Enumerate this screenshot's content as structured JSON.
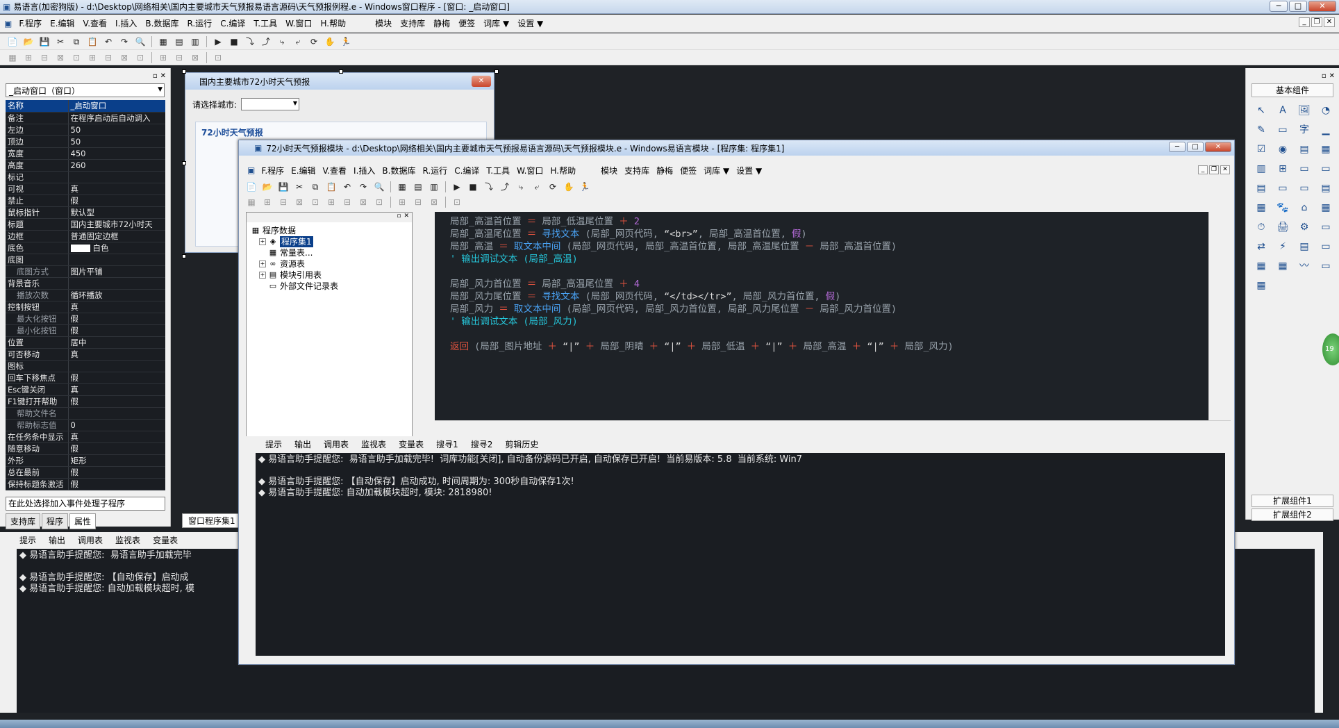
{
  "title": "易语言(加密狗版) - d:\\Desktop\\网络相关\\国内主要城市天气预报易语言源码\\天气预报例程.e - Windows窗口程序 - [窗口: _启动窗口]",
  "menu": [
    "F.程序",
    "E.编辑",
    "V.查看",
    "I.插入",
    "B.数据库",
    "R.运行",
    "C.编译",
    "T.工具",
    "W.窗口",
    "H.帮助"
  ],
  "menu_extra": [
    "模块",
    "支持库",
    "静梅",
    "便签",
    "词库 ▼",
    "设置 ▼"
  ],
  "toolbar1": [
    "📄",
    "📂",
    "💾",
    "✂",
    "⧉",
    "📋",
    "↶",
    "↷",
    "🔍",
    "▦",
    "▤",
    "▥",
    "▶",
    "■",
    "⤵",
    "⤴",
    "⤷",
    "⤶",
    "⟳",
    "✋",
    "🏃"
  ],
  "toolbar2": [
    "▦",
    "⊞",
    "⊟",
    "⊠",
    "⊡",
    "⊞",
    "⊟",
    "⊠",
    "⊡",
    "⊞",
    "⊟",
    "⊠",
    "⊡"
  ],
  "leftpanel": {
    "combo": "_启动窗口（窗口）",
    "props": [
      {
        "k": "名称",
        "v": "_启动窗口",
        "sel": true
      },
      {
        "k": "备注",
        "v": "在程序启动后自动调入"
      },
      {
        "k": "左边",
        "v": "50"
      },
      {
        "k": "顶边",
        "v": "50"
      },
      {
        "k": "宽度",
        "v": "450"
      },
      {
        "k": "高度",
        "v": "260"
      },
      {
        "k": "标记",
        "v": ""
      },
      {
        "k": "可视",
        "v": "真"
      },
      {
        "k": "禁止",
        "v": "假"
      },
      {
        "k": "鼠标指针",
        "v": "默认型"
      },
      {
        "k": "标题",
        "v": "国内主要城市72小时天"
      },
      {
        "k": "边框",
        "v": "普通固定边框"
      },
      {
        "k": "底色",
        "v": "白色",
        "color": true
      },
      {
        "k": "底图",
        "v": ""
      },
      {
        "k": "底图方式",
        "v": "图片平铺",
        "sub": true
      },
      {
        "k": "背景音乐",
        "v": ""
      },
      {
        "k": "播放次数",
        "v": "循环播放",
        "sub": true
      },
      {
        "k": "控制按钮",
        "v": "真"
      },
      {
        "k": "最大化按钮",
        "v": "假",
        "sub": true
      },
      {
        "k": "最小化按钮",
        "v": "假",
        "sub": true
      },
      {
        "k": "位置",
        "v": "居中"
      },
      {
        "k": "可否移动",
        "v": "真"
      },
      {
        "k": "图标",
        "v": ""
      },
      {
        "k": "回车下移焦点",
        "v": "假"
      },
      {
        "k": "Esc键关闭",
        "v": "真"
      },
      {
        "k": "F1键打开帮助",
        "v": "假"
      },
      {
        "k": "帮助文件名",
        "v": "",
        "sub": true
      },
      {
        "k": "帮助标志值",
        "v": "0",
        "sub": true
      },
      {
        "k": "在任务条中显示",
        "v": "真"
      },
      {
        "k": "随意移动",
        "v": "假"
      },
      {
        "k": "外形",
        "v": "矩形"
      },
      {
        "k": "总在最前",
        "v": "假"
      },
      {
        "k": "保持标题条激活",
        "v": "假"
      }
    ],
    "event_combo": "在此处选择加入事件处理子程序",
    "tabs": [
      "支持库",
      "程序",
      "属性"
    ],
    "doc_tab": "窗口程序集1"
  },
  "design": {
    "title": "国内主要城市72小时天气预报",
    "select_label": "请选择城市:",
    "group_title": "72小时天气预报"
  },
  "toolbox": {
    "title": "基本组件",
    "icons": [
      "↖",
      "A",
      "🖼",
      "◔",
      "✎",
      "▭",
      "字",
      "▁",
      "☑",
      "◉",
      "▤",
      "▦",
      "▥",
      "⊞",
      "▭",
      "▭",
      "▤",
      "▭",
      "▭",
      "▤",
      "▦",
      "🐾",
      "⌂",
      "▦",
      "⏱",
      "🖨",
      "⚙",
      "▭",
      "⇄",
      "⚡",
      "▤",
      "▭",
      "▦",
      "▦",
      "〰",
      "▭",
      "▦"
    ],
    "ext1": "扩展组件1",
    "ext2": "扩展组件2"
  },
  "greenball": "19",
  "output_tabs": [
    "提示",
    "输出",
    "调用表",
    "监视表",
    "变量表",
    "搜寻1",
    "搜寻2",
    "剪辑历史"
  ],
  "bottom_output": "◆ 易语言助手提醒您:  易语言助手加载完毕\n\n◆ 易语言助手提醒您: 【自动保存】启动成\n◆ 易语言助手提醒您: 自动加载模块超时, 模",
  "module": {
    "title": "72小时天气预报模块 - d:\\Desktop\\网络相关\\国内主要城市天气预报易语言源码\\天气预报模块.e - Windows易语言模块 - [程序集: 程序集1]",
    "tree": [
      {
        "label": "程序数据",
        "level": 0,
        "icon": "▦"
      },
      {
        "label": "程序集1",
        "level": 1,
        "pm": "+",
        "icon": "◈",
        "sel": true
      },
      {
        "label": "常量表...",
        "level": 1,
        "icon": "▦"
      },
      {
        "label": "资源表",
        "level": 1,
        "pm": "+",
        "icon": "∞"
      },
      {
        "label": "模块引用表",
        "level": 1,
        "pm": "+",
        "icon": "▤"
      },
      {
        "label": "外部文件记录表",
        "level": 1,
        "icon": "▭"
      }
    ],
    "tree_tabs": [
      "支持库",
      "程序",
      "属性"
    ],
    "output": "◆ 易语言助手提醒您:  易语言助手加载完毕!  词库功能[关闭], 自动备份源码已开启, 自动保存已开启!  当前易版本: 5.8  当前系统: Win7\n\n◆ 易语言助手提醒您: 【自动保存】启动成功, 时间周期为: 300秒自动保存1次!\n◆ 易语言助手提醒您: 自动加载模块超时, 模块: 2818980!"
  },
  "code": {
    "l1": {
      "a": "局部_高温首位置",
      "b": "局部_低温尾位置",
      "c": "2"
    },
    "l2": {
      "a": "局部_高温尾位置",
      "f": "寻找文本",
      "p1": "(局部_网页代码, ",
      "s": "“<br>”",
      "p2": ", 局部_高温首位置, ",
      "b": "假",
      "e": ")"
    },
    "l3": {
      "a": "局部_高温",
      "f": "取文本中间",
      "p1": "(局部_网页代码, 局部_高温首位置, 局部_高温尾位置 ",
      "p2": " 局部_高温首位置)"
    },
    "l4": "' 输出调试文本 (局部_高温)",
    "l5": {
      "a": "局部_风力首位置",
      "b": "局部_高温尾位置",
      "c": "4"
    },
    "l6": {
      "a": "局部_风力尾位置",
      "f": "寻找文本",
      "p1": "(局部_网页代码, ",
      "s": "“</td></tr>”",
      "p2": ", 局部_风力首位置, ",
      "b": "假",
      "e": ")"
    },
    "l7": {
      "a": "局部_风力",
      "f": "取文本中间",
      "p1": "(局部_网页代码, 局部_风力首位置, 局部_风力尾位置 ",
      "p2": " 局部_风力首位置)"
    },
    "l8": "' 输出调试文本 (局部_风力)",
    "l9": {
      "kw": "返回",
      "t1": " (局部_图片地址 ",
      "q": "“|”",
      "t2": " 局部_阴晴 ",
      "t3": " 局部_低温 ",
      "t4": " 局部_高温 ",
      "t5": " 局部_风力)"
    },
    "eq": "＝",
    "plus": "＋",
    "minus": "－"
  }
}
